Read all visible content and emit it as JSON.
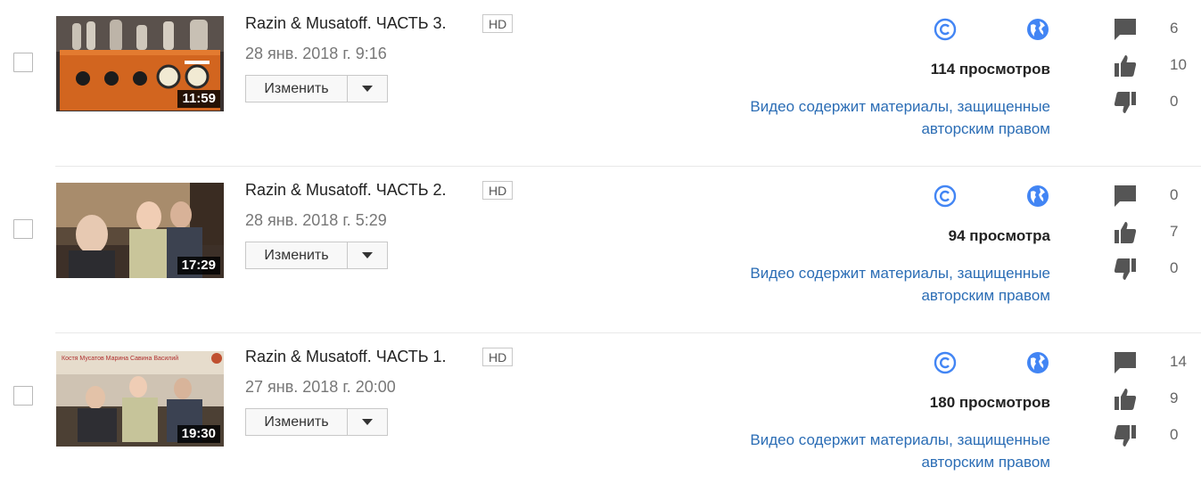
{
  "videos": [
    {
      "title": "Razin & Musatoff. ЧАСТЬ 3.",
      "quality": "HD",
      "date": "28 янв. 2018 г. 9:16",
      "duration": "11:59",
      "edit_label": "Изменить",
      "views": "114 просмотров",
      "claim": "Видео содержит материалы, защищенные авторским правом",
      "comments": "6",
      "likes": "10",
      "dislikes": "0"
    },
    {
      "title": "Razin & Musatoff. ЧАСТЬ 2.",
      "quality": "HD",
      "date": "28 янв. 2018 г. 5:29",
      "duration": "17:29",
      "edit_label": "Изменить",
      "views": "94 просмотра",
      "claim": "Видео содержит материалы, защищенные авторским правом",
      "comments": "0",
      "likes": "7",
      "dislikes": "0"
    },
    {
      "title": "Razin & Musatoff. ЧАСТЬ 1.",
      "quality": "HD",
      "date": "27 янв. 2018 г. 20:00",
      "duration": "19:30",
      "edit_label": "Изменить",
      "views": "180 просмотров",
      "claim": "Видео содержит материалы, защищенные авторским правом",
      "comments": "14",
      "likes": "9",
      "dislikes": "0",
      "thumbnail_caption": "Костя Мусатов   Марина Савина   Василий"
    }
  ],
  "icons": {
    "copyright": "copyright-icon",
    "visibility": "globe-icon",
    "comments": "comment-icon",
    "likes": "thumbs-up-icon",
    "dislikes": "thumbs-down-icon",
    "dropdown": "caret-down-icon"
  },
  "colors": {
    "link": "#2b6db5",
    "icon_blue": "#4285f4",
    "icon_gray": "#555555"
  }
}
